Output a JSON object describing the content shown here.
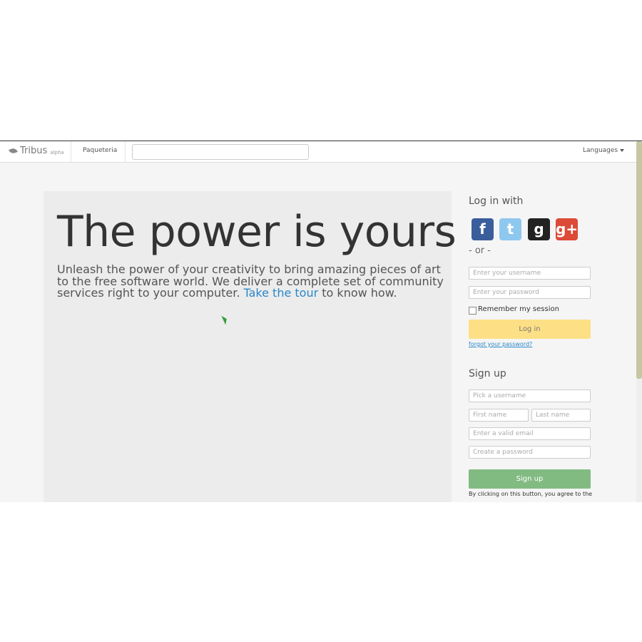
{
  "navbar": {
    "brand": "Tribus",
    "brand_tag": "alpha",
    "link": "Paqueteria",
    "search_value": "",
    "languages": "Languages"
  },
  "hero": {
    "title": "The power is yours",
    "text_before": "Unleash the power of your creativity to bring amazing pieces of art to the free software world. We deliver a complete set of community services right to your computer. ",
    "link": "Take the tour",
    "text_after": " to know how."
  },
  "login": {
    "heading": "Log in with",
    "social": [
      {
        "name": "facebook",
        "glyph": "f",
        "color": "#3a5d9c"
      },
      {
        "name": "twitter",
        "glyph": "t",
        "color": "#8ec8ef"
      },
      {
        "name": "github",
        "glyph": "g",
        "color": "#222222"
      },
      {
        "name": "google-plus",
        "glyph": "g+",
        "color": "#dc4a38"
      }
    ],
    "or": "- or -",
    "username_placeholder": "Enter your username",
    "password_placeholder": "Enter your password",
    "remember": "Remember my session",
    "button": "Log in",
    "forgot": "forgot your password?"
  },
  "signup": {
    "heading": "Sign up",
    "username_placeholder": "Pick a username",
    "first_name_placeholder": "First name",
    "last_name_placeholder": "Last name",
    "email_placeholder": "Enter a valid email",
    "password_placeholder": "Create a password",
    "button": "Sign up",
    "terms": "By clicking on this button, you agree to the"
  },
  "colors": {
    "login_button": "#fde086",
    "signup_button": "#82bb82",
    "link": "#2a87c8"
  }
}
